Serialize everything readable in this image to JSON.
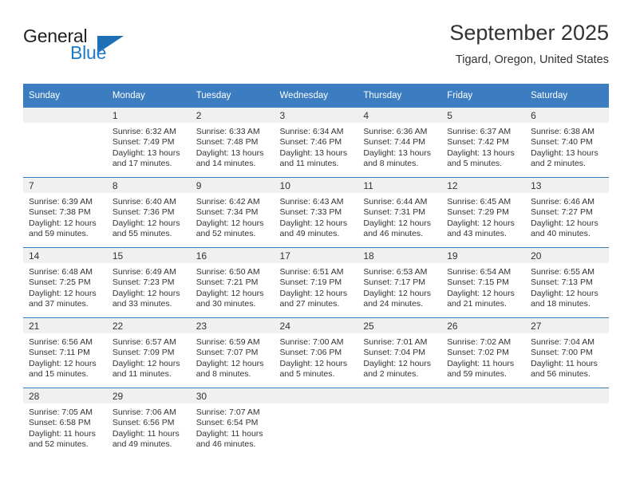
{
  "brand": {
    "name_part1": "General",
    "name_part2": "Blue",
    "triangle_color": "#1f6fb6",
    "blue_text_color": "#1f7ac4"
  },
  "header": {
    "title": "September 2025",
    "subtitle": "Tigard, Oregon, United States"
  },
  "theme": {
    "header_blue": "#3b7dc0",
    "daynum_band": "#f0f0f0",
    "text": "#333333"
  },
  "calendar": {
    "weekday_headers": [
      "Sunday",
      "Monday",
      "Tuesday",
      "Wednesday",
      "Thursday",
      "Friday",
      "Saturday"
    ],
    "weeks": [
      [
        {
          "day": "",
          "empty": true,
          "lines": []
        },
        {
          "day": "1",
          "empty": false,
          "lines": [
            "Sunrise: 6:32 AM",
            "Sunset: 7:49 PM",
            "Daylight: 13 hours",
            "and 17 minutes."
          ]
        },
        {
          "day": "2",
          "empty": false,
          "lines": [
            "Sunrise: 6:33 AM",
            "Sunset: 7:48 PM",
            "Daylight: 13 hours",
            "and 14 minutes."
          ]
        },
        {
          "day": "3",
          "empty": false,
          "lines": [
            "Sunrise: 6:34 AM",
            "Sunset: 7:46 PM",
            "Daylight: 13 hours",
            "and 11 minutes."
          ]
        },
        {
          "day": "4",
          "empty": false,
          "lines": [
            "Sunrise: 6:36 AM",
            "Sunset: 7:44 PM",
            "Daylight: 13 hours",
            "and 8 minutes."
          ]
        },
        {
          "day": "5",
          "empty": false,
          "lines": [
            "Sunrise: 6:37 AM",
            "Sunset: 7:42 PM",
            "Daylight: 13 hours",
            "and 5 minutes."
          ]
        },
        {
          "day": "6",
          "empty": false,
          "lines": [
            "Sunrise: 6:38 AM",
            "Sunset: 7:40 PM",
            "Daylight: 13 hours",
            "and 2 minutes."
          ]
        }
      ],
      [
        {
          "day": "7",
          "empty": false,
          "lines": [
            "Sunrise: 6:39 AM",
            "Sunset: 7:38 PM",
            "Daylight: 12 hours",
            "and 59 minutes."
          ]
        },
        {
          "day": "8",
          "empty": false,
          "lines": [
            "Sunrise: 6:40 AM",
            "Sunset: 7:36 PM",
            "Daylight: 12 hours",
            "and 55 minutes."
          ]
        },
        {
          "day": "9",
          "empty": false,
          "lines": [
            "Sunrise: 6:42 AM",
            "Sunset: 7:34 PM",
            "Daylight: 12 hours",
            "and 52 minutes."
          ]
        },
        {
          "day": "10",
          "empty": false,
          "lines": [
            "Sunrise: 6:43 AM",
            "Sunset: 7:33 PM",
            "Daylight: 12 hours",
            "and 49 minutes."
          ]
        },
        {
          "day": "11",
          "empty": false,
          "lines": [
            "Sunrise: 6:44 AM",
            "Sunset: 7:31 PM",
            "Daylight: 12 hours",
            "and 46 minutes."
          ]
        },
        {
          "day": "12",
          "empty": false,
          "lines": [
            "Sunrise: 6:45 AM",
            "Sunset: 7:29 PM",
            "Daylight: 12 hours",
            "and 43 minutes."
          ]
        },
        {
          "day": "13",
          "empty": false,
          "lines": [
            "Sunrise: 6:46 AM",
            "Sunset: 7:27 PM",
            "Daylight: 12 hours",
            "and 40 minutes."
          ]
        }
      ],
      [
        {
          "day": "14",
          "empty": false,
          "lines": [
            "Sunrise: 6:48 AM",
            "Sunset: 7:25 PM",
            "Daylight: 12 hours",
            "and 37 minutes."
          ]
        },
        {
          "day": "15",
          "empty": false,
          "lines": [
            "Sunrise: 6:49 AM",
            "Sunset: 7:23 PM",
            "Daylight: 12 hours",
            "and 33 minutes."
          ]
        },
        {
          "day": "16",
          "empty": false,
          "lines": [
            "Sunrise: 6:50 AM",
            "Sunset: 7:21 PM",
            "Daylight: 12 hours",
            "and 30 minutes."
          ]
        },
        {
          "day": "17",
          "empty": false,
          "lines": [
            "Sunrise: 6:51 AM",
            "Sunset: 7:19 PM",
            "Daylight: 12 hours",
            "and 27 minutes."
          ]
        },
        {
          "day": "18",
          "empty": false,
          "lines": [
            "Sunrise: 6:53 AM",
            "Sunset: 7:17 PM",
            "Daylight: 12 hours",
            "and 24 minutes."
          ]
        },
        {
          "day": "19",
          "empty": false,
          "lines": [
            "Sunrise: 6:54 AM",
            "Sunset: 7:15 PM",
            "Daylight: 12 hours",
            "and 21 minutes."
          ]
        },
        {
          "day": "20",
          "empty": false,
          "lines": [
            "Sunrise: 6:55 AM",
            "Sunset: 7:13 PM",
            "Daylight: 12 hours",
            "and 18 minutes."
          ]
        }
      ],
      [
        {
          "day": "21",
          "empty": false,
          "lines": [
            "Sunrise: 6:56 AM",
            "Sunset: 7:11 PM",
            "Daylight: 12 hours",
            "and 15 minutes."
          ]
        },
        {
          "day": "22",
          "empty": false,
          "lines": [
            "Sunrise: 6:57 AM",
            "Sunset: 7:09 PM",
            "Daylight: 12 hours",
            "and 11 minutes."
          ]
        },
        {
          "day": "23",
          "empty": false,
          "lines": [
            "Sunrise: 6:59 AM",
            "Sunset: 7:07 PM",
            "Daylight: 12 hours",
            "and 8 minutes."
          ]
        },
        {
          "day": "24",
          "empty": false,
          "lines": [
            "Sunrise: 7:00 AM",
            "Sunset: 7:06 PM",
            "Daylight: 12 hours",
            "and 5 minutes."
          ]
        },
        {
          "day": "25",
          "empty": false,
          "lines": [
            "Sunrise: 7:01 AM",
            "Sunset: 7:04 PM",
            "Daylight: 12 hours",
            "and 2 minutes."
          ]
        },
        {
          "day": "26",
          "empty": false,
          "lines": [
            "Sunrise: 7:02 AM",
            "Sunset: 7:02 PM",
            "Daylight: 11 hours",
            "and 59 minutes."
          ]
        },
        {
          "day": "27",
          "empty": false,
          "lines": [
            "Sunrise: 7:04 AM",
            "Sunset: 7:00 PM",
            "Daylight: 11 hours",
            "and 56 minutes."
          ]
        }
      ],
      [
        {
          "day": "28",
          "empty": false,
          "lines": [
            "Sunrise: 7:05 AM",
            "Sunset: 6:58 PM",
            "Daylight: 11 hours",
            "and 52 minutes."
          ]
        },
        {
          "day": "29",
          "empty": false,
          "lines": [
            "Sunrise: 7:06 AM",
            "Sunset: 6:56 PM",
            "Daylight: 11 hours",
            "and 49 minutes."
          ]
        },
        {
          "day": "30",
          "empty": false,
          "lines": [
            "Sunrise: 7:07 AM",
            "Sunset: 6:54 PM",
            "Daylight: 11 hours",
            "and 46 minutes."
          ]
        },
        {
          "day": "",
          "empty": true,
          "lines": []
        },
        {
          "day": "",
          "empty": true,
          "lines": []
        },
        {
          "day": "",
          "empty": true,
          "lines": []
        },
        {
          "day": "",
          "empty": true,
          "lines": []
        }
      ]
    ]
  }
}
